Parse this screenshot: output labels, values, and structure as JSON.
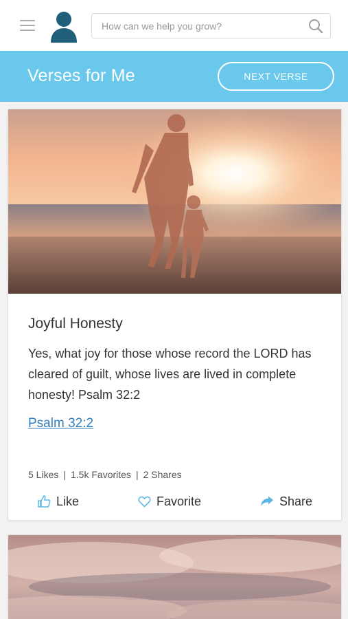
{
  "header": {
    "search_placeholder": "How can we help you grow?",
    "menu_icon": "hamburger-menu-icon",
    "avatar_icon": "user-avatar-icon",
    "search_icon": "search-icon"
  },
  "banner": {
    "title": "Verses for Me",
    "next_button": "NEXT VERSE",
    "color": "#69c8ec"
  },
  "cards": [
    {
      "title": "Joyful Honesty",
      "text": "Yes, what joy for those whose record the LORD has cleared of guilt, whose lives are lived in complete honesty! Psalm 32:2",
      "reference_link": "Psalm 32:2",
      "stats": {
        "likes": "5 Likes",
        "favorites": "1.5k Favorites",
        "shares": "2 Shares",
        "separator": "|"
      },
      "actions": {
        "like": "Like",
        "favorite": "Favorite",
        "share": "Share"
      }
    }
  ],
  "colors": {
    "accent": "#69c8ec",
    "link": "#2f7fc1",
    "avatar": "#1f5f7a"
  }
}
